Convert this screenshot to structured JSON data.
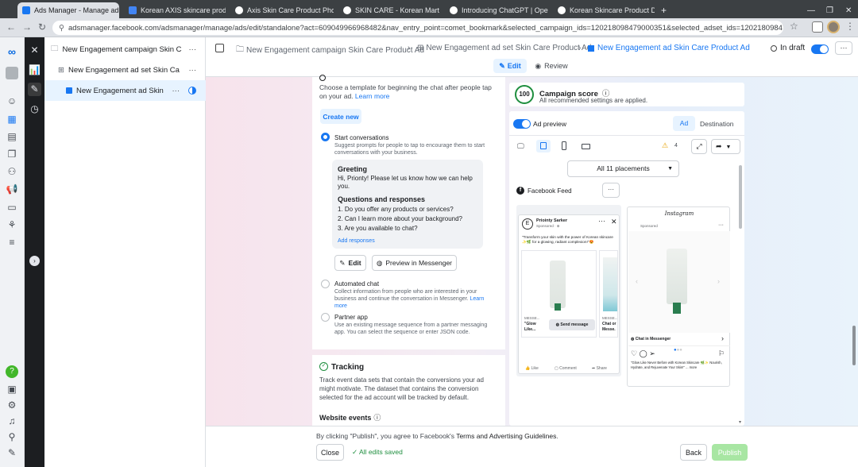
{
  "browser": {
    "tabs": [
      {
        "title": "Ads Manager - Manage ads -",
        "color": "#1877f2"
      },
      {
        "title": "Korean AXIS skincare product",
        "color": "#4285f4"
      },
      {
        "title": "Axis Skin Care Product Photos",
        "color": "#111111"
      },
      {
        "title": "SKIN CARE - Korean Mart",
        "color": "#333333"
      },
      {
        "title": "Introducing ChatGPT | OpenAI",
        "color": "#222222"
      },
      {
        "title": "Korean Skincare Product Desc",
        "color": "#555555"
      }
    ],
    "new_tab": "+",
    "url": "adsmanager.facebook.com/adsmanager/manage/ads/edit/standalone?act=609049966968482&nav_entry_point=comet_bookmark&selected_campaign_ids=120218098479000351&selected_adset_ids=120218098479100351&selected_ad_ids=120218098..."
  },
  "tree": {
    "campaign": "New Engagement campaign Skin Care Pr...",
    "adset": "New Engagement ad set Skin Care Pro...",
    "ad": "New Engagement ad Skin Car...",
    "dots": "···"
  },
  "header": {
    "crumb_campaign": "New Engagement campaign Skin Care Product Ad",
    "crumb_adset": "New Engagement ad set Skin Care Product Ad",
    "crumb_ad": "New Engagement ad Skin Care Product Ad",
    "status": "In draft",
    "edit_tab": "Edit",
    "review_tab": "Review",
    "more": "···"
  },
  "template": {
    "intro": "Choose a template for beginning the chat after people tap on your ad.",
    "learn_more": "Learn more",
    "create_new": "Create new",
    "start_title": "Start conversations",
    "start_desc": "Suggest prompts for people to tap to encourage them to start conversations with your business.",
    "greeting_label": "Greeting",
    "greeting_text": "Hi, Prionty! Please let us know how we can help you.",
    "qr_label": "Questions and responses",
    "questions": [
      "1. Do you offer any products or services?",
      "2. Can I learn more about your background?",
      "3. Are you available to chat?"
    ],
    "add_responses": "Add responses",
    "edit_btn": "Edit",
    "preview_btn": "Preview in Messenger",
    "auto_title": "Automated chat",
    "auto_desc": "Collect information from people who are interested in your business and continue the conversation in Messenger.",
    "auto_learn": "Learn more",
    "partner_title": "Partner app",
    "partner_desc": "Use an existing message sequence from a partner messaging app. You can select the sequence or enter JSON code."
  },
  "tracking": {
    "title": "Tracking",
    "desc": "Track event data sets that contain the conversions your ad might motivate. The dataset that contains the conversion selected for the ad account will be tracked by default.",
    "website_events": "Website events"
  },
  "score": {
    "value": "100",
    "title": "Campaign score",
    "subtitle": "All recommended settings are applied."
  },
  "preview": {
    "toggle_label": "Ad preview",
    "tab_ad": "Ad",
    "tab_destination": "Destination",
    "warning_count": "4",
    "placements": "All 11 placements",
    "feed_label": "Facebook Feed",
    "more": "···",
    "fb_page": "Priointy Sarker",
    "fb_sponsored": "Sponsored · ⊕",
    "fb_text": "\"Transform your skin with the power of Korean skincare ✨🌿 for a glowing, radiant complexion!\"😍",
    "fb_card_label": "MESSE...",
    "fb_card_title": "\"Glow Like...",
    "fb_send": "Send message",
    "fb_card2_label": "MESSE...",
    "fb_card2_title": "Chat or Messe.",
    "fb_like": "Like",
    "fb_comment": "Comment",
    "fb_share": "Share",
    "ig_logo": "Instagram",
    "ig_sponsored": "Sponsored",
    "ig_chat": "Chat in Messenger",
    "ig_caption": "\"Glow Like Never Before with Korean Skincare 🌿✨ Nourish, Hydrate, and Rejuvenate Your Skin!\" ... more"
  },
  "footer": {
    "terms_prefix": "By clicking \"Publish\", you agree to Facebook's",
    "terms_link": "Terms and Advertising Guidelines",
    "close": "Close",
    "saved": "All edits saved",
    "back": "Back",
    "publish": "Publish"
  },
  "colors": {
    "accent": "#1877f2",
    "success": "#1e8e3e"
  }
}
